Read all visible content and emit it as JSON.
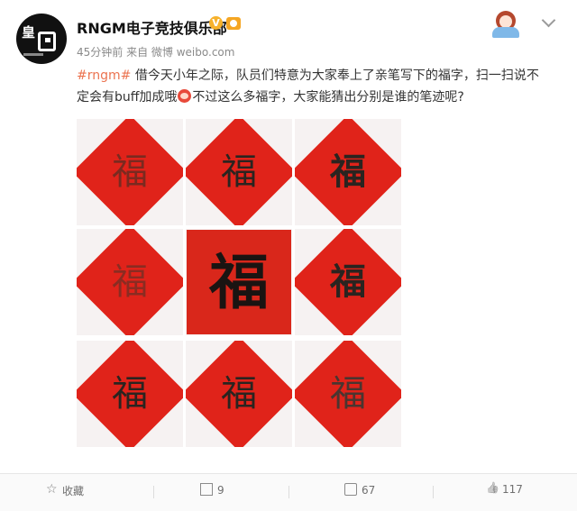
{
  "user": {
    "name": "RNGM电子竞技俱乐部",
    "verified_mark": "V",
    "avatar_text": "皇"
  },
  "meta": {
    "time": "45分钟前",
    "source": "来自 微博 weibo.com"
  },
  "post": {
    "hashtag": "#rngm#",
    "line1": " 借今天小年之际，队员们特意为大家奉上了亲笔写下的福字，扫一扫说不",
    "line2_a": "定会有buff加成哦",
    "line2_b": "不过这么多福字，大家能猜出分别是谁的笔迹呢?"
  },
  "images": [
    {
      "char": "福",
      "style": "diamond"
    },
    {
      "char": "福",
      "style": "diamond"
    },
    {
      "char": "福",
      "style": "diamond"
    },
    {
      "char": "福",
      "style": "diamond"
    },
    {
      "char": "福",
      "style": "square"
    },
    {
      "char": "福",
      "style": "diamond"
    },
    {
      "char": "福",
      "style": "diamond"
    },
    {
      "char": "福",
      "style": "diamond"
    },
    {
      "char": "福",
      "style": "diamond"
    }
  ],
  "actions": {
    "favorite": "收藏",
    "repost_count": "9",
    "comment_count": "67",
    "like_count": "117"
  },
  "colors": {
    "hashtag": "#eb7350",
    "paper_red": "#e0231a",
    "verified": "#f7b22c"
  }
}
